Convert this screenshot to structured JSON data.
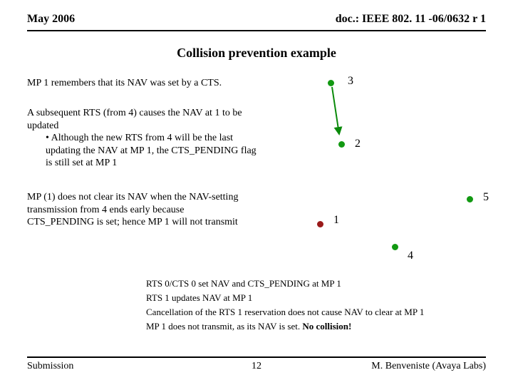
{
  "header": {
    "left": "May 2006",
    "right": "doc.: IEEE 802. 11 -06/0632 r 1"
  },
  "title": "Collision prevention example",
  "paragraphs": {
    "p1": "MP 1 remembers that its NAV was set by a CTS.",
    "p2_line1": "A subsequent RTS (from 4) causes the NAV at 1 to be updated",
    "p2_bullet": "• Although the new RTS from 4 will be the last updating the NAV at MP 1, the CTS_PENDING flag is still set at MP 1",
    "p3": "MP (1) does not clear its NAV when the NAV-setting transmission from 4 ends early because CTS_PENDING is set; hence MP 1 will not transmit"
  },
  "nodes": {
    "n1": "1",
    "n2": "2",
    "n3": "3",
    "n4": "4",
    "n5": "5"
  },
  "colors": {
    "green": "#129912",
    "red": "#9a1a1a",
    "arrow": "#0a8a0a"
  },
  "notes": {
    "l1": "RTS 0/CTS 0 set NAV and CTS_PENDING at MP 1",
    "l2": "RTS 1 updates NAV at MP 1",
    "l3": "Cancellation of the RTS 1 reservation does not cause NAV to clear at MP 1",
    "l4_a": "MP 1 does not transmit, as its NAV is set. ",
    "l4_b": "No collision!"
  },
  "footer": {
    "left": "Submission",
    "center": "12",
    "right": "M. Benveniste (Avaya Labs)"
  }
}
